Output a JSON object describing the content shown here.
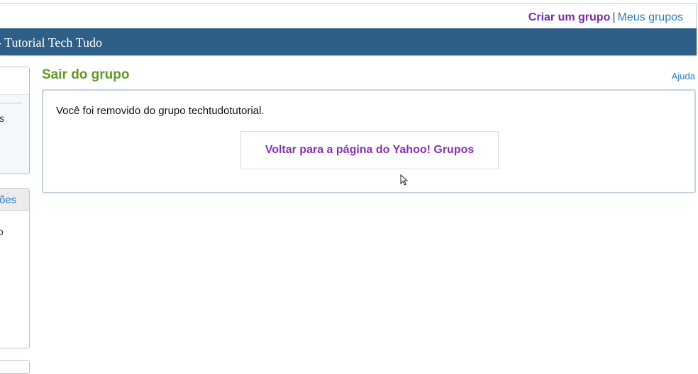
{
  "header": {
    "create_group": "Criar um grupo",
    "separator": "|",
    "my_groups": "Meus grupos"
  },
  "group_bar": {
    "title": "- Tutorial Tech Tudo"
  },
  "sidebar": {
    "fragment_1": "s",
    "panel2_head": "ões",
    "fragment_2": "o"
  },
  "main": {
    "title": "Sair do grupo",
    "help": "Ajuda",
    "message": "Você foi removido do grupo techtudotutorial.",
    "back_button": "Voltar para a página do Yahoo! Grupos"
  },
  "colors": {
    "accent_purple": "#7b2aa8",
    "link_blue": "#2a7ac7",
    "header_bar": "#2e5f86",
    "title_green": "#5f9a22"
  },
  "icons": {
    "cursor": "mouse-pointer-icon"
  }
}
